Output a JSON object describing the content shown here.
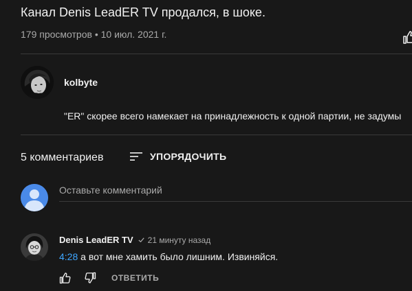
{
  "video": {
    "title": "Канал Denis LeadER TV продался, в шоке.",
    "meta": "179 просмотров • 10 июл. 2021 г."
  },
  "channel": {
    "name": "kolbyte",
    "description": "\"ER\" скорее всего намекает на принадлежность к одной партии, не задумы"
  },
  "comments_section": {
    "count_label": "5 комментариев",
    "sort_label": "УПОРЯДОЧИТЬ",
    "input_placeholder": "Оставьте комментарий"
  },
  "comments": [
    {
      "author": "Denis LeadER TV",
      "time": "21 минуту назад",
      "timestamp_link": "4:28",
      "text": " а вот мне хамить было лишним. Извиняйся.",
      "reply_label": "ОТВЕТИТЬ"
    }
  ],
  "colors": {
    "background": "#181818",
    "text": "#f1f1f1",
    "secondary_text": "#aaaaaa",
    "link": "#3ea6ff",
    "default_avatar": "#4a8ae8"
  },
  "icons": [
    "thumb-up-icon",
    "sort-icon",
    "default-avatar-icon",
    "verified-check-icon",
    "thumb-down-icon"
  ]
}
